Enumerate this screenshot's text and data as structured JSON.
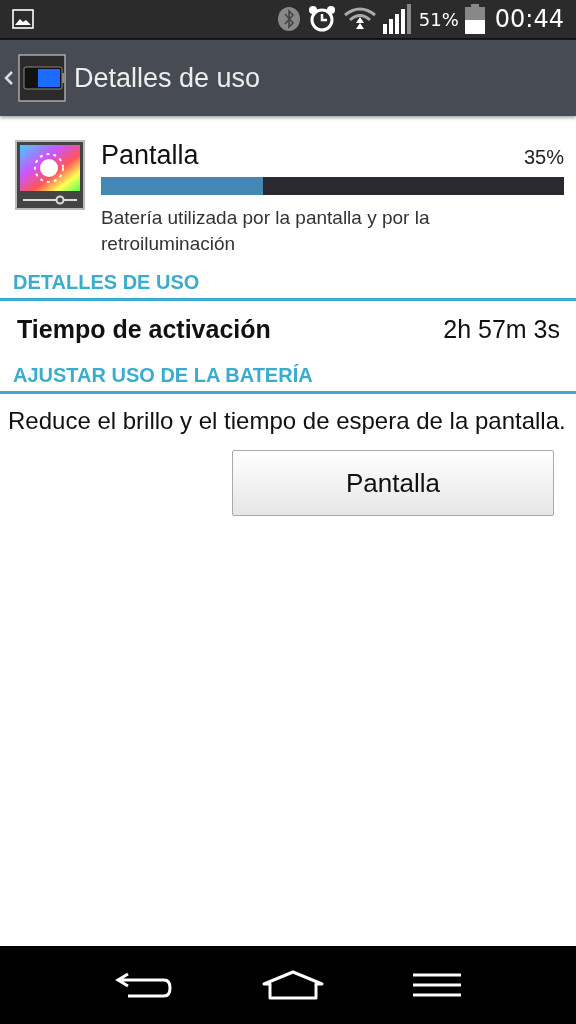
{
  "status_bar": {
    "battery_percent": "51%",
    "time": "00:44"
  },
  "action_bar": {
    "title": "Detalles de uso"
  },
  "app": {
    "name": "Pantalla",
    "percent": "35%",
    "level": 0.35,
    "description": "Batería utilizada por la pantalla y por la retroiluminación"
  },
  "sections": [
    {
      "header": "DETALLES DE USO",
      "kind": "stat",
      "label": "Tiempo de activación",
      "value": "2h 57m 3s"
    },
    {
      "header": "AJUSTAR USO DE LA BATERÍA",
      "kind": "action",
      "text": "Reduce el brillo y el tiempo de espera de la pantalla.",
      "button": "Pantalla"
    }
  ]
}
